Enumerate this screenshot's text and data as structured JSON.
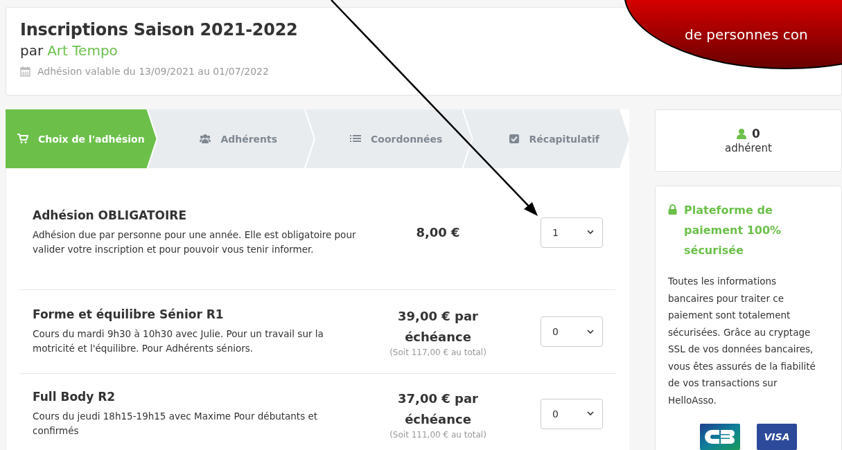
{
  "header": {
    "title": "Inscriptions Saison 2021-2022",
    "by_prefix": "par",
    "organization": "Art Tempo",
    "validity": "Adhésion valable du 13/09/2021 au 01/07/2022"
  },
  "steps": [
    {
      "label": "Choix de l'adhésion",
      "kind": "cart",
      "selected": true
    },
    {
      "label": "Adhérents",
      "kind": "users",
      "selected": false
    },
    {
      "label": "Coordonnées",
      "kind": "list",
      "selected": false
    },
    {
      "label": "Récapitulatif",
      "kind": "check",
      "selected": false
    }
  ],
  "offers": [
    {
      "name": "Adhésion OBLIGATOIRE",
      "description": "Adhésion due par personne pour une année. Elle est obligatoire pour valider votre inscription et pour pouvoir vous tenir informer.",
      "price": "8,00 €",
      "quantity": "1"
    },
    {
      "name": "Forme et équilibre Sénior R1",
      "description": "Cours du mardi 9h30 à 10h30 avec Julie. Pour un travail sur la motricité et l'équilibre. Pour Adhérents séniors.",
      "price": "39,00 € par échéance",
      "total": "(Soit 117,00 € au total)",
      "quantity": "0"
    },
    {
      "name": "Full Body R2",
      "description": "Cours du jeudi 18h15-19h15 avec Maxime Pour débutants et confirmés",
      "price": "37,00 € par échéance",
      "total": "(Soit 111,00 € au total)",
      "quantity": "0"
    }
  ],
  "members": {
    "count": "0",
    "label": "adhérent"
  },
  "security": {
    "title": "Plateforme de paiement 100% sécurisée",
    "text": "Toutes les informations bancaires pour traiter ce paiement sont totalement sécurisées. Grâce au cryptage SSL de vos données bancaires, vous êtes assurés de la fiabilité de vos transactions sur HelloAsso.",
    "card_logos": [
      {
        "kind": "cb"
      },
      {
        "kind": "visa",
        "label": "VISA"
      }
    ]
  },
  "callout": {
    "text": "de personnes con"
  }
}
